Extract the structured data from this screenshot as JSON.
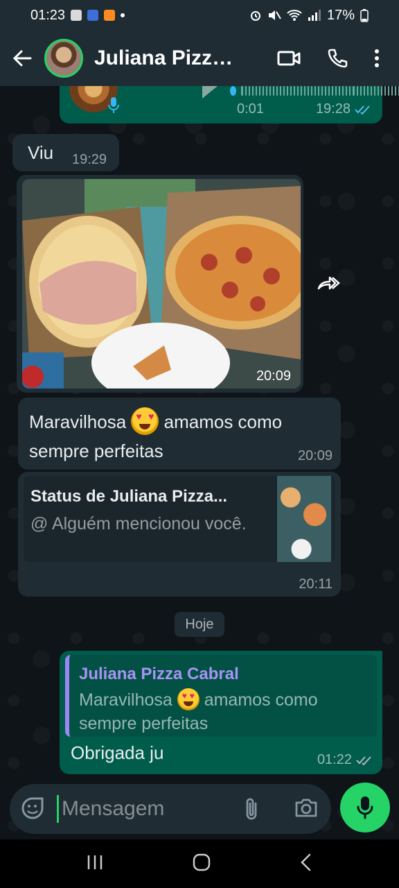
{
  "status_bar": {
    "time": "01:23",
    "battery": "17%"
  },
  "header": {
    "contact_name": "Juliana Pizza..."
  },
  "messages": {
    "audio": {
      "duration": "0:01",
      "time": "19:28"
    },
    "viu": {
      "text": "Viu",
      "time": "19:29"
    },
    "image": {
      "time": "20:09"
    },
    "text1": {
      "line1": "Maravilhosa",
      "line1b": "amamos como",
      "line2": "sempre perfeitas",
      "time": "20:09"
    },
    "status_mention": {
      "title": "Status de Juliana Pizza...",
      "subtitle": "@ Alguém mencionou você.",
      "time": "20:11"
    },
    "date_chip": "Hoje",
    "reply": {
      "quoted_name": "Juliana Pizza Cabral",
      "quoted_line1": "Maravilhosa",
      "quoted_line1b": "amamos como",
      "quoted_line2": "sempre perfeitas",
      "text": "Obrigada ju",
      "time": "01:22"
    }
  },
  "composer": {
    "placeholder": "Mensagem"
  },
  "colors": {
    "accent": "#25d366",
    "outgoing_bubble": "#005c4b",
    "incoming_bubble": "#1f2c34",
    "read_tick": "#53bdeb"
  },
  "icons": [
    "back-arrow-icon",
    "video-call-icon",
    "phone-icon",
    "more-icon",
    "mic-icon",
    "play-icon",
    "forward-icon",
    "double-check-icon",
    "sticker-icon",
    "attach-icon",
    "camera-icon"
  ]
}
